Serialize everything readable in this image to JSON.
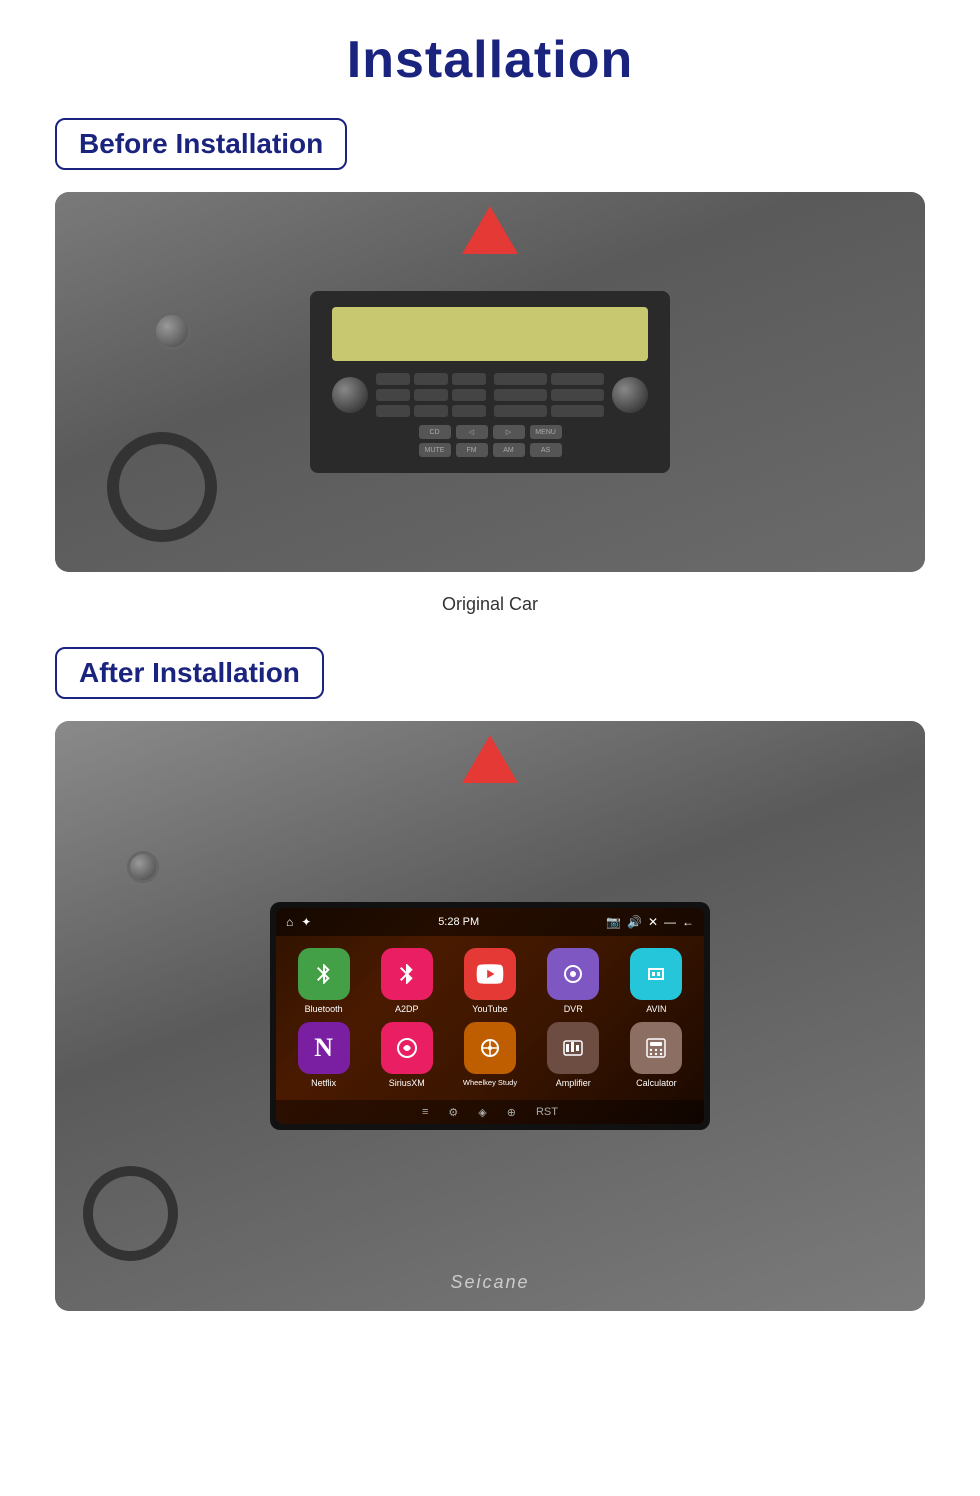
{
  "page": {
    "title": "Installation",
    "before_label": "Before Installation",
    "after_label": "After Installation",
    "original_caption": "Original Car",
    "seicane_brand": "Seicane"
  },
  "status_bar": {
    "time": "5:28 PM",
    "home_icon": "⌂",
    "wifi_icon": "▾",
    "camera_icon": "📷",
    "sound_icon": "🔊",
    "x_icon": "✕",
    "minus_icon": "—",
    "back_icon": "←"
  },
  "apps": [
    {
      "id": "bluetooth",
      "label": "Bluetooth",
      "icon": "⚡",
      "color_class": "app-bluetooth"
    },
    {
      "id": "a2dp",
      "label": "A2DP",
      "icon": "❋",
      "color_class": "app-a2dp"
    },
    {
      "id": "youtube",
      "label": "YouTube",
      "icon": "▶",
      "color_class": "app-youtube"
    },
    {
      "id": "dvr",
      "label": "DVR",
      "icon": "◎",
      "color_class": "app-dvr"
    },
    {
      "id": "avin",
      "label": "AVIN",
      "icon": "⇥",
      "color_class": "app-avin"
    },
    {
      "id": "netflix",
      "label": "Netflix",
      "icon": "N",
      "color_class": "app-netflix"
    },
    {
      "id": "siriusxm",
      "label": "SiriusXM",
      "icon": "⊛",
      "color_class": "app-siriusxm"
    },
    {
      "id": "wheelkey",
      "label": "Wheelkey Study",
      "icon": "⊕",
      "color_class": "app-wheelkey"
    },
    {
      "id": "amplifier",
      "label": "Amplifier",
      "icon": "▦",
      "color_class": "app-amplifier"
    },
    {
      "id": "calculator",
      "label": "Calculator",
      "icon": "▦",
      "color_class": "app-calculator"
    }
  ]
}
